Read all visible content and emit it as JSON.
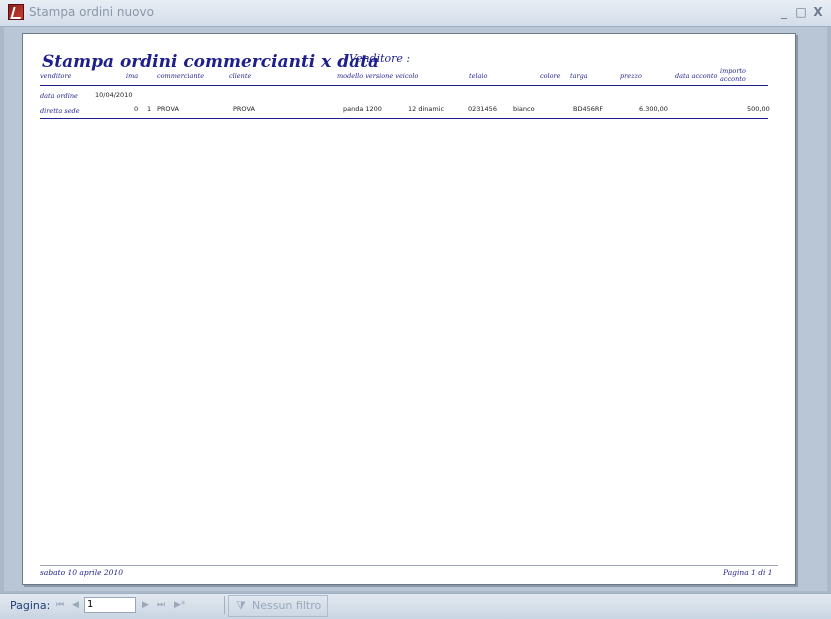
{
  "window": {
    "title": "Stampa ordini nuovo",
    "minimize": "_",
    "maximize": "□",
    "close": "X"
  },
  "report": {
    "title": "Stampa ordini commercianti x data",
    "venditore_label": "Venditore :",
    "headers": {
      "venditore": "venditore",
      "ima": "ima",
      "commerciante": "commerciante",
      "cliente": "cliente",
      "modello": "modello versione veicolo",
      "telaio": "telaio",
      "colore": "colore",
      "targa": "targa",
      "prezzo": "prezzo",
      "data_acconto": "data acconto",
      "importo_acconto_1": "importo",
      "importo_acconto_2": "acconto"
    },
    "data_ordine_label": "data ordine",
    "data_ordine_value": "10/04/2010",
    "diretta_label": "diretta sede",
    "row": {
      "col0": "0",
      "col1": "1",
      "commerciante": "PROVA",
      "cliente": "PROVA",
      "modello": "panda 1200",
      "versione": "12 dinamic",
      "telaio": "0231456",
      "colore": "bianco",
      "targa": "BD456RF",
      "prezzo": "6.300,00",
      "acconto": "500,00"
    },
    "footer_date": "sabato 10 aprile 2010",
    "footer_page": "Pagina 1 di 1"
  },
  "statusbar": {
    "page_label": "Pagina:",
    "page_value": "1",
    "filter_label": "Nessun filtro",
    "nav_first": "⏮",
    "nav_prev": "◀",
    "nav_next": "▶",
    "nav_last": "⏭",
    "nav_new": "▶*"
  }
}
